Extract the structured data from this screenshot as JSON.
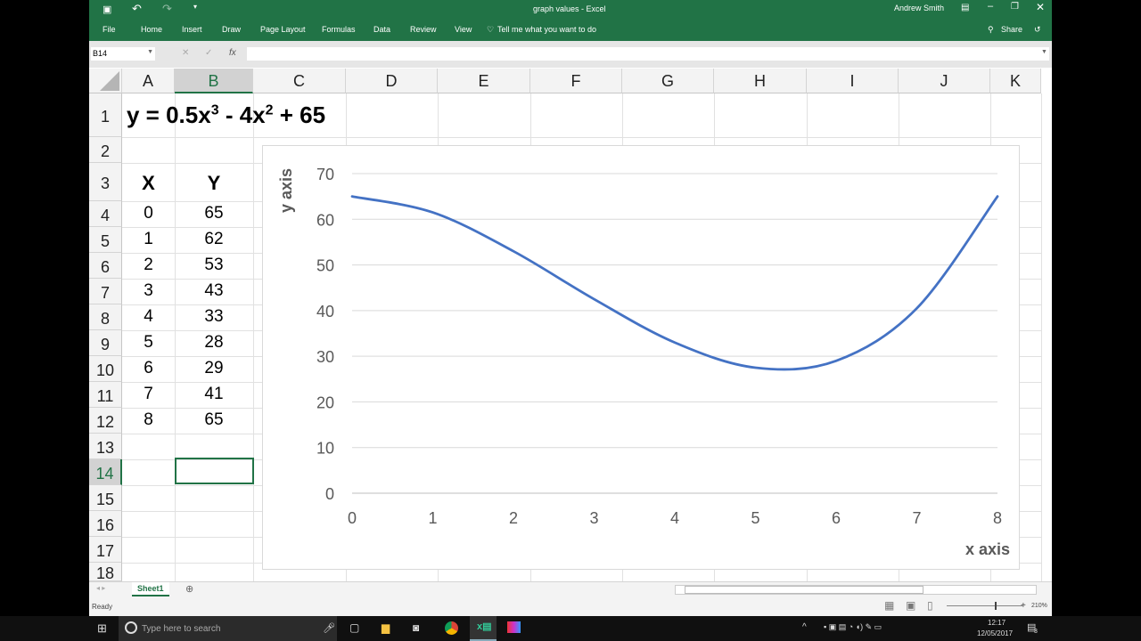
{
  "window": {
    "title": "graph values  -  Excel",
    "user": "Andrew Smith",
    "share": "Share"
  },
  "ribbon": {
    "tabs": [
      "File",
      "Home",
      "Insert",
      "Draw",
      "Page Layout",
      "Formulas",
      "Data",
      "Review",
      "View"
    ],
    "tell_me": "Tell me what you want to do"
  },
  "formula_bar": {
    "name_box": "B14",
    "fx": "fx",
    "value": ""
  },
  "columns": [
    "A",
    "B",
    "C",
    "D",
    "E",
    "F",
    "G",
    "H",
    "I",
    "J",
    "K"
  ],
  "rows": [
    "1",
    "2",
    "3",
    "4",
    "5",
    "6",
    "7",
    "8",
    "9",
    "10",
    "11",
    "12",
    "13",
    "14",
    "15",
    "16",
    "17",
    "18"
  ],
  "sheet": {
    "equation": {
      "a": "y = 0.5x",
      "e1": "3",
      "b": " - 4x",
      "e2": "2",
      "c": " + 65"
    },
    "headers": [
      "X",
      "Y"
    ],
    "x": [
      "0",
      "1",
      "2",
      "3",
      "4",
      "5",
      "6",
      "7",
      "8"
    ],
    "y": [
      "65",
      "62",
      "53",
      "43",
      "33",
      "28",
      "29",
      "41",
      "65"
    ]
  },
  "chart_data": {
    "type": "line",
    "smooth": true,
    "x": [
      0,
      1,
      2,
      3,
      4,
      5,
      6,
      7,
      8
    ],
    "series": [
      {
        "name": "Y",
        "values": [
          65,
          61.5,
          53,
          42.5,
          33,
          27.5,
          29,
          40.5,
          65
        ],
        "color": "#4472c4"
      }
    ],
    "xlabel": "x axis",
    "ylabel": "y axis",
    "xlim": [
      0,
      8
    ],
    "ylim": [
      0,
      70
    ],
    "xticks": [
      "0",
      "1",
      "2",
      "3",
      "4",
      "5",
      "6",
      "7",
      "8"
    ],
    "yticks": [
      "0",
      "10",
      "20",
      "30",
      "40",
      "50",
      "60",
      "70"
    ],
    "grid": true
  },
  "tabs": {
    "sheet1": "Sheet1"
  },
  "status": {
    "ready": "Ready",
    "zoom": "210%"
  },
  "taskbar": {
    "search": "Type here to search",
    "time": "12:17",
    "date": "12/05/2017",
    "notifications": "3"
  }
}
